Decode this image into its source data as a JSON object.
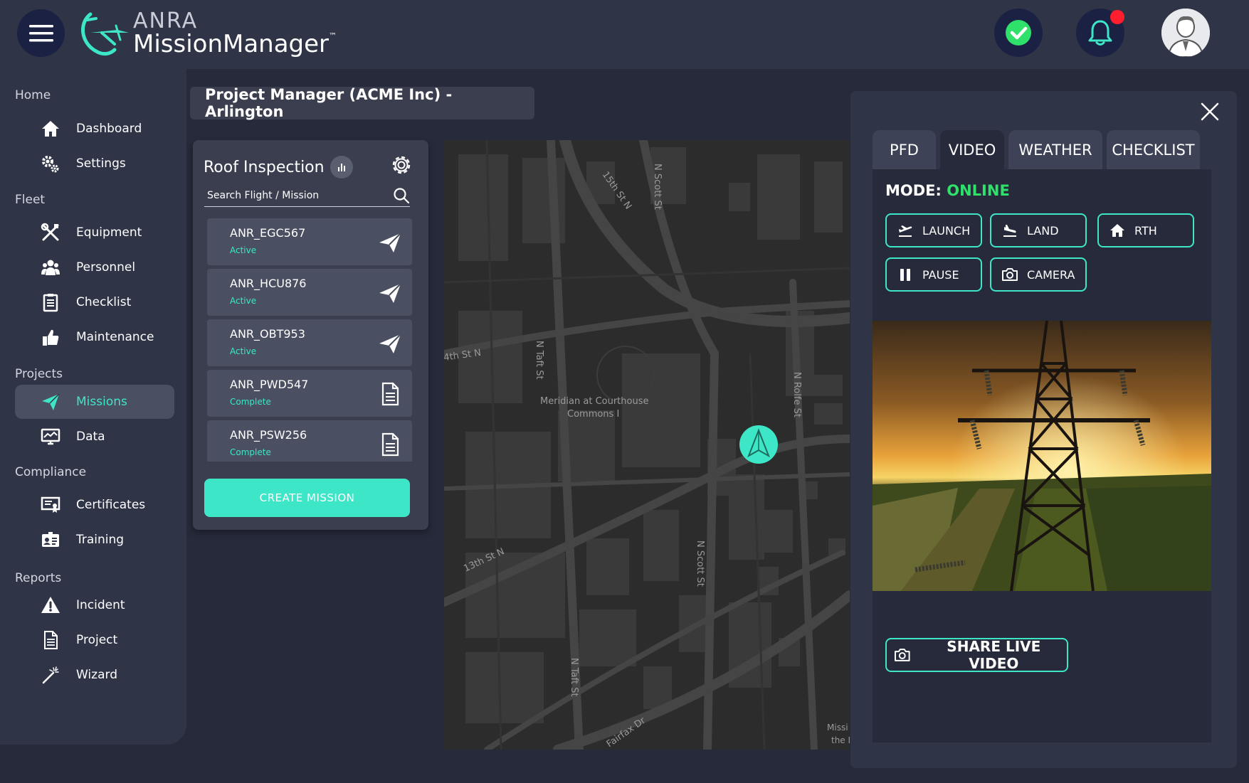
{
  "app": {
    "logo_top": "ANRA",
    "logo_bottom": "MissionManager",
    "logo_tm": "™"
  },
  "sidebar": {
    "sections": [
      {
        "label": "Home",
        "items": [
          {
            "label": "Dashboard",
            "icon": "home-icon"
          },
          {
            "label": "Settings",
            "icon": "gears-icon"
          }
        ]
      },
      {
        "label": "Fleet",
        "items": [
          {
            "label": "Equipment",
            "icon": "tools-icon"
          },
          {
            "label": "Personnel",
            "icon": "users-icon"
          },
          {
            "label": "Checklist",
            "icon": "clipboard-icon"
          },
          {
            "label": "Maintenance",
            "icon": "thumbs-up-icon"
          }
        ]
      },
      {
        "label": "Projects",
        "items": [
          {
            "label": "Missions",
            "icon": "paper-plane-icon",
            "active": true
          },
          {
            "label": "Data",
            "icon": "monitor-chart-icon"
          }
        ]
      },
      {
        "label": "Compliance",
        "items": [
          {
            "label": "Certificates",
            "icon": "certificate-icon"
          },
          {
            "label": "Training",
            "icon": "id-card-icon"
          }
        ]
      },
      {
        "label": "Reports",
        "items": [
          {
            "label": "Incident",
            "icon": "warning-icon"
          },
          {
            "label": "Project",
            "icon": "document-icon"
          },
          {
            "label": "Wizard",
            "icon": "wand-icon"
          }
        ]
      }
    ]
  },
  "project": {
    "title": "Project Manager (ACME Inc) - Arlington"
  },
  "missions": {
    "title": "Roof Inspection",
    "search_placeholder": "Search Flight / Mission",
    "flights": [
      {
        "name": "ANR_EGC567",
        "status": "Active",
        "icon": "paper-plane-icon"
      },
      {
        "name": "ANR_HCU876",
        "status": "Active",
        "icon": "paper-plane-icon"
      },
      {
        "name": "ANR_OBT953",
        "status": "Active",
        "icon": "paper-plane-icon"
      },
      {
        "name": "ANR_PWD547",
        "status": "Complete",
        "icon": "document-icon"
      },
      {
        "name": "ANR_PSW256",
        "status": "Complete",
        "icon": "document-icon"
      }
    ],
    "create_label": "CREATE MISSION"
  },
  "map": {
    "labels": {
      "street_15th": "15th St N",
      "street_nscott_top": "N Scott St",
      "street_14th": "4th St N",
      "street_ntaft_top": "N Taft St",
      "place_line1": "Meridian at Courthouse",
      "place_line2": "Commons I",
      "street_nrolfe": "N Rolfe St",
      "street_13th": "13th St N",
      "street_nscott_bottom": "N Scott St",
      "street_ntaft_bottom": "N Taft St",
      "street_fairfax": "Fairfax Dr",
      "edge_1": "Missi",
      "edge_2": "the I"
    }
  },
  "panel": {
    "tabs": [
      {
        "label": "PFD"
      },
      {
        "label": "VIDEO",
        "active": true
      },
      {
        "label": "WEATHER"
      },
      {
        "label": "CHECKLIST"
      }
    ],
    "mode_label": "MODE:",
    "mode_value": "ONLINE",
    "controls": {
      "launch": "LAUNCH",
      "land": "LAND",
      "rth": "RTH",
      "pause": "PAUSE",
      "camera": "CAMERA"
    },
    "share_label": "SHARE LIVE VIDEO"
  },
  "colors": {
    "accent": "#3ee6c8",
    "online": "#2fe06b",
    "notification": "#ff1e2e",
    "background": "#262a3a",
    "panel": "#2f3447"
  }
}
